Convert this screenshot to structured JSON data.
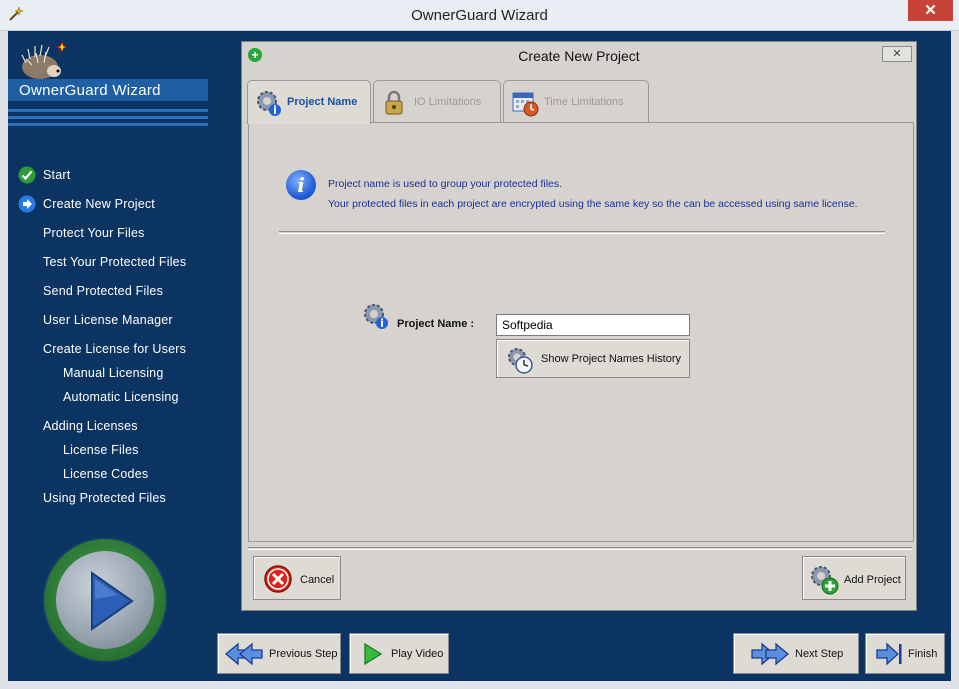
{
  "window": {
    "title": "OwnerGuard Wizard",
    "close_glyph": "✕"
  },
  "sidebar": {
    "brand": "OwnerGuard Wizard",
    "items": [
      {
        "label": "Start",
        "level": 1,
        "icon": "check-icon"
      },
      {
        "label": "Create New Project",
        "level": 1,
        "icon": "arrow-right-circle-icon"
      },
      {
        "label": "Protect Your Files",
        "level": 1
      },
      {
        "label": "Test Your Protected Files",
        "level": 1
      },
      {
        "label": "Send Protected Files",
        "level": 1
      },
      {
        "label": "User License Manager",
        "level": 1
      },
      {
        "label": "Create License for Users",
        "level": 1
      },
      {
        "label": "Manual Licensing",
        "level": 2
      },
      {
        "label": "Automatic Licensing",
        "level": 2
      },
      {
        "label": "Adding Licenses",
        "level": 1
      },
      {
        "label": "License Files",
        "level": 2
      },
      {
        "label": "License Codes",
        "level": 2
      },
      {
        "label": "Using Protected Files",
        "level": 1
      }
    ]
  },
  "dialog": {
    "title": "Create New Project",
    "close_glyph": "✕",
    "tabs": [
      {
        "label": "Project Name",
        "active": true,
        "icon": "gear-info-icon"
      },
      {
        "label": "IO Limitations",
        "active": false,
        "icon": "lock-icon"
      },
      {
        "label": "Time Limitations",
        "active": false,
        "icon": "calendar-clock-icon"
      }
    ],
    "info_lines": [
      "Project name is used to group your protected files.",
      "Your protected files in each project are encrypted using the same key so the can be accessed using same license."
    ],
    "project_name_label": "Project Name :",
    "project_name_value": "Softpedia",
    "history_button": "Show Project Names History",
    "cancel_button": "Cancel",
    "add_project_button": "Add Project"
  },
  "navbar": {
    "previous_step": "Previous Step",
    "play_video": "Play Video",
    "next_step": "Next Step",
    "finish": "Finish"
  },
  "colors": {
    "sidebar_bg": "#0c3462",
    "brand_bar": "#1f5fa4",
    "dialog_bg": "#d6d3ce",
    "info_text": "#1a2f9a",
    "active_tab_text": "#1a4fa0"
  }
}
